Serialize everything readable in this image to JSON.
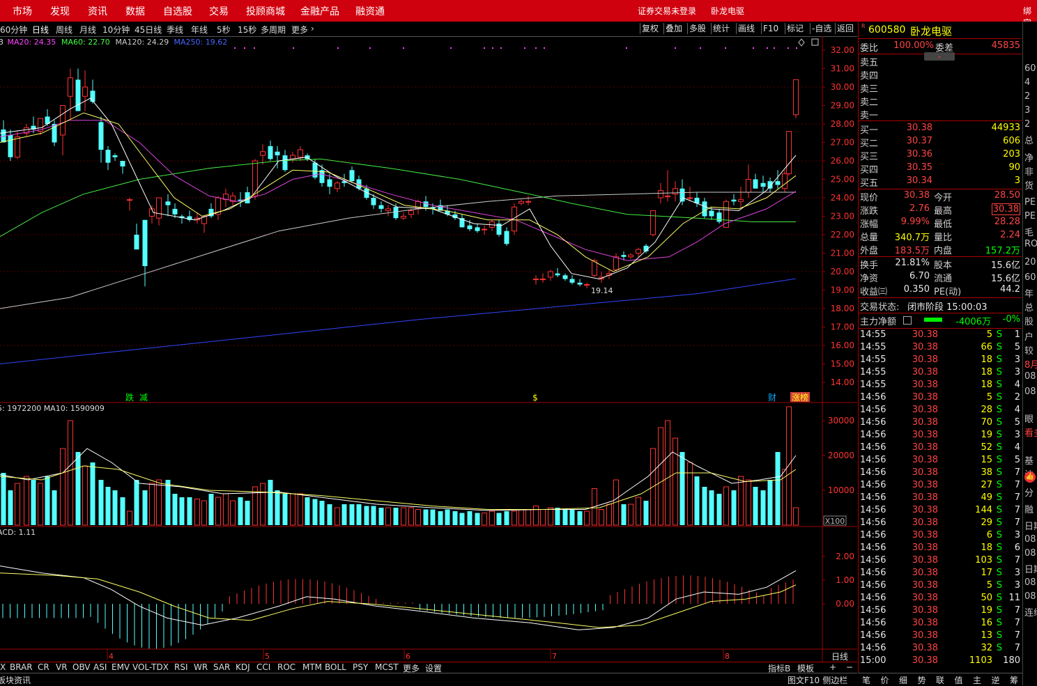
{
  "topnav": {
    "items": [
      "市场",
      "发现",
      "资讯",
      "数据",
      "自选股",
      "交易",
      "投顾商城",
      "金融产品",
      "融资通"
    ],
    "login_status": "证券交易未登录",
    "stock_name": "卧龙电驱",
    "bind": "绑定"
  },
  "toolbar": {
    "periods": [
      "60分钟",
      "日线",
      "周线",
      "月线",
      "10分钟",
      "45日线",
      "季线",
      "年线",
      "5秒",
      "15秒",
      "多周期",
      "更多"
    ],
    "active_period": "日线",
    "buttons": [
      "复权",
      "叠加",
      "多股",
      "统计",
      "画线",
      "F10",
      "标记",
      "-自选",
      "返回"
    ]
  },
  "main_chart": {
    "legend": [
      {
        "text": "3",
        "color": "#dddddd"
      },
      {
        "text": "MA20: 24.35",
        "color": "#ff44ff"
      },
      {
        "text": "MA60: 22.70",
        "color": "#44ff44"
      },
      {
        "text": "MA120: 24.29",
        "color": "#cccccc"
      },
      {
        "text": "MA250: 19.62",
        "color": "#4466ff"
      }
    ],
    "y_ticks": [
      "32.00",
      "31.00",
      "30.00",
      "29.00",
      "28.00",
      "27.00",
      "26.00",
      "25.00",
      "24.00",
      "23.00",
      "22.00",
      "21.00",
      "20.00",
      "19.00",
      "18.00",
      "17.00",
      "16.00",
      "15.00",
      "14.00"
    ],
    "low_label": "19.14",
    "markers": [
      "跌",
      "减",
      "$",
      "财",
      "涨榜"
    ]
  },
  "volume_chart": {
    "legend": "5: 1972200  MA10: 1590909",
    "y_ticks": [
      "30000",
      "20000",
      "10000"
    ],
    "unit": "X100"
  },
  "macd_chart": {
    "legend": "ACD: 1.11",
    "y_ticks": [
      "2.00",
      "1.00",
      "0.00"
    ]
  },
  "x_axis": {
    "labels": [
      "4",
      "5",
      "6",
      "7",
      "8"
    ],
    "corner": "日线"
  },
  "bottom_tabs": [
    "X",
    "BRAR",
    "CR",
    "VR",
    "OBV",
    "ASI",
    "EMV",
    "VOL-TDX",
    "RSI",
    "WR",
    "SAR",
    "KDJ",
    "CCI",
    "ROC",
    "MTM",
    "BOLL",
    "PSY",
    "MCST",
    "更多",
    "设置"
  ],
  "bottom_right": [
    "指标B",
    "模板",
    "+",
    "−"
  ],
  "status_left": "板块资讯",
  "status_right": [
    "图文F10",
    "侧边栏"
  ],
  "quote": {
    "code": "600580",
    "name": "卧龙电驱",
    "weibi_label": "委比",
    "weibi": "100.00%",
    "weicha_label": "委差",
    "weicha": "45835",
    "sell_labels": [
      "卖五",
      "卖四",
      "卖三",
      "卖二",
      "卖一"
    ],
    "buy": [
      {
        "label": "买一",
        "price": "30.38",
        "vol": "44933"
      },
      {
        "label": "买二",
        "price": "30.37",
        "vol": "606"
      },
      {
        "label": "买三",
        "price": "30.36",
        "vol": "203"
      },
      {
        "label": "买四",
        "price": "30.35",
        "vol": "90"
      },
      {
        "label": "买五",
        "price": "30.34",
        "vol": "3"
      }
    ],
    "stats": [
      {
        "l1": "现价",
        "v1": "30.38",
        "c1": "red",
        "l2": "今开",
        "v2": "28.50",
        "c2": "red"
      },
      {
        "l1": "涨跌",
        "v1": "2.76",
        "c1": "red",
        "l2": "最高",
        "v2": "30.38",
        "c2": "red"
      },
      {
        "l1": "涨幅",
        "v1": "9.99%",
        "c1": "red",
        "l2": "最低",
        "v2": "28.28",
        "c2": "red"
      },
      {
        "l1": "总量",
        "v1": "340.7万",
        "c1": "yellow",
        "l2": "量比",
        "v2": "2.24",
        "c2": "red"
      },
      {
        "l1": "外盘",
        "v1": "183.5万",
        "c1": "red",
        "l2": "内盘",
        "v2": "157.2万",
        "c2": "green"
      }
    ],
    "stats2": [
      {
        "l1": "换手",
        "v1": "21.81%",
        "l2": "股本",
        "v2": "15.6亿"
      },
      {
        "l1": "净资",
        "v1": "6.70",
        "l2": "流通",
        "v2": "15.6亿"
      },
      {
        "l1": "收益㈢",
        "v1": "0.350",
        "l2": "PE(动)",
        "v2": "44.2"
      }
    ],
    "trade_state_label": "交易状态:",
    "trade_state": "闭市阶段 15:00:03",
    "main_flow_label": "主力净额",
    "main_flow": "-4006万",
    "main_flow_pct": "-0%"
  },
  "ticks": [
    {
      "t": "14:55",
      "p": "30.38",
      "v": "5",
      "s": "S",
      "n": "1"
    },
    {
      "t": "14:55",
      "p": "30.38",
      "v": "66",
      "s": "S",
      "n": "5"
    },
    {
      "t": "14:55",
      "p": "30.38",
      "v": "18",
      "s": "S",
      "n": "3"
    },
    {
      "t": "14:55",
      "p": "30.38",
      "v": "18",
      "s": "S",
      "n": "3"
    },
    {
      "t": "14:55",
      "p": "30.38",
      "v": "18",
      "s": "S",
      "n": "4"
    },
    {
      "t": "14:56",
      "p": "30.38",
      "v": "5",
      "s": "S",
      "n": "2"
    },
    {
      "t": "14:56",
      "p": "30.38",
      "v": "28",
      "s": "S",
      "n": "4"
    },
    {
      "t": "14:56",
      "p": "30.38",
      "v": "70",
      "s": "S",
      "n": "5"
    },
    {
      "t": "14:56",
      "p": "30.38",
      "v": "19",
      "s": "S",
      "n": "3"
    },
    {
      "t": "14:56",
      "p": "30.38",
      "v": "52",
      "s": "S",
      "n": "4"
    },
    {
      "t": "14:56",
      "p": "30.38",
      "v": "15",
      "s": "S",
      "n": "5"
    },
    {
      "t": "14:56",
      "p": "30.38",
      "v": "38",
      "s": "S",
      "n": "7"
    },
    {
      "t": "14:56",
      "p": "30.38",
      "v": "27",
      "s": "S",
      "n": "7"
    },
    {
      "t": "14:56",
      "p": "30.38",
      "v": "49",
      "s": "S",
      "n": "7"
    },
    {
      "t": "14:56",
      "p": "30.38",
      "v": "144",
      "s": "S",
      "n": "7"
    },
    {
      "t": "14:56",
      "p": "30.38",
      "v": "29",
      "s": "S",
      "n": "7"
    },
    {
      "t": "14:56",
      "p": "30.38",
      "v": "6",
      "s": "S",
      "n": "3"
    },
    {
      "t": "14:56",
      "p": "30.38",
      "v": "18",
      "s": "S",
      "n": "6"
    },
    {
      "t": "14:56",
      "p": "30.38",
      "v": "103",
      "s": "S",
      "n": "7"
    },
    {
      "t": "14:56",
      "p": "30.38",
      "v": "17",
      "s": "S",
      "n": "3"
    },
    {
      "t": "14:56",
      "p": "30.38",
      "v": "5",
      "s": "S",
      "n": "3"
    },
    {
      "t": "14:56",
      "p": "30.38",
      "v": "50",
      "s": "S",
      "n": "11"
    },
    {
      "t": "14:56",
      "p": "30.38",
      "v": "19",
      "s": "S",
      "n": "7"
    },
    {
      "t": "14:56",
      "p": "30.38",
      "v": "16",
      "s": "S",
      "n": "7"
    },
    {
      "t": "14:56",
      "p": "30.38",
      "v": "13",
      "s": "S",
      "n": "7"
    },
    {
      "t": "14:56",
      "p": "30.38",
      "v": "32",
      "s": "S",
      "n": "7"
    },
    {
      "t": "15:00",
      "p": "30.38",
      "v": "1103",
      "s": "",
      "n": "180"
    }
  ],
  "rp_bottom_tabs": [
    "笔",
    "价",
    "细",
    "势",
    "联",
    "值",
    "主",
    "逆",
    "筹"
  ],
  "far_right": [
    "60",
    "4",
    "2",
    "3",
    "2",
    "总",
    "净",
    "非",
    "货",
    "PE",
    "PE",
    "毛",
    "RO",
    "20",
    "60",
    "年",
    "总",
    "股",
    "户",
    "较",
    "8月",
    "08",
    "08",
    "眼",
    "看多",
    "",
    "基",
    "法",
    "分",
    "融",
    "日期",
    "08",
    "08",
    "日期",
    "08",
    "08",
    "连续"
  ]
}
